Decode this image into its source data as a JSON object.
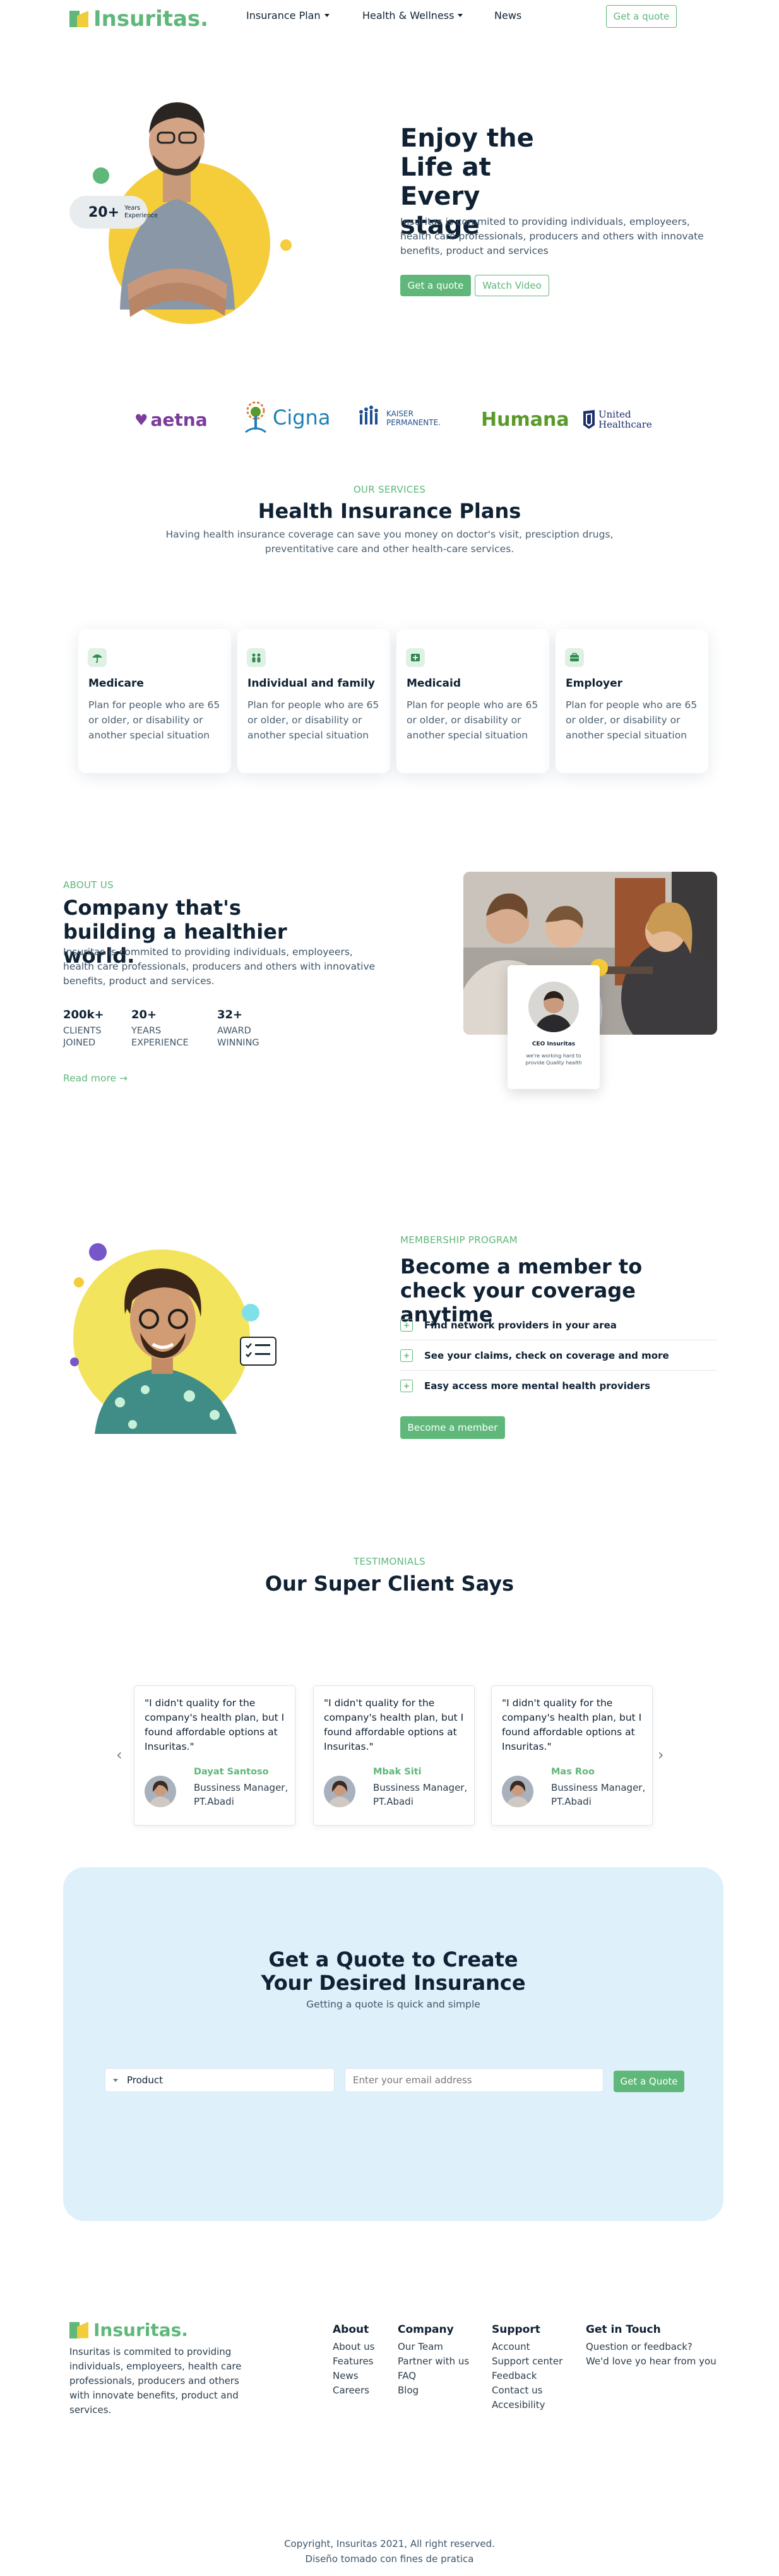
{
  "nav": {
    "logo_text": "Insuritas.",
    "items": [
      {
        "label": "Insurance Plan",
        "dropdown": true
      },
      {
        "label": "Health & Wellness",
        "dropdown": true
      },
      {
        "label": "News",
        "dropdown": false
      }
    ],
    "cta": "Get a quote"
  },
  "hero": {
    "badge_number": "20+",
    "badge_text_1": "Years",
    "badge_text_2": "Experience",
    "title": "Enjoy the Life at Every stage",
    "description": "Insuritas is commited to providing individuals, employeers, health care professionals, producers and others with innovate benefits, product and services",
    "primary_button": "Get a quote",
    "secondary_button": "Watch Video"
  },
  "partners": [
    {
      "name": "aetna",
      "color": "#7b3b9b"
    },
    {
      "name": "Cigna",
      "color": "#1e7fb4"
    },
    {
      "name_line1": "KAISER",
      "name_line2": "PERMANENTE.",
      "color": "#1f4f8c"
    },
    {
      "name": "Humana",
      "color": "#5a9a2a"
    },
    {
      "name_line1": "United",
      "name_line2": "Healthcare",
      "color": "#1c2f6b"
    }
  ],
  "services": {
    "kicker": "OUR SERVICES",
    "title": "Health Insurance Plans",
    "description": "Having health insurance coverage can save you money on doctor's visit, presciption drugs, preventitative care and other health-care services.",
    "cards": [
      {
        "icon": "umbrella-icon",
        "title": "Medicare",
        "text": "Plan for people who are 65 or older, or disability or another special situation"
      },
      {
        "icon": "family-icon",
        "title": "Individual and family",
        "text": "Plan for people who are 65 or older, or disability or another special situation"
      },
      {
        "icon": "medical-icon",
        "title": "Medicaid",
        "text": "Plan for people who are 65 or older, or disability or another special situation"
      },
      {
        "icon": "briefcase-icon",
        "title": "Employer",
        "text": "Plan for people who are 65 or older, or disability or another special situation"
      }
    ]
  },
  "about": {
    "kicker": "ABOUT US",
    "title": "Company that's building a healthier world.",
    "description": "Insuritas is commited to providing individuals, employeers, health care professionals, producers and others with innovative benefits, product and services.",
    "stats": [
      {
        "value": "200k+",
        "label_1": "CLIENTS",
        "label_2": "JOINED"
      },
      {
        "value": "20+",
        "label_1": "YEARS",
        "label_2": "EXPERIENCE"
      },
      {
        "value": "32+",
        "label_1": "AWARD",
        "label_2": "WINNING"
      }
    ],
    "read_more": "Read more →",
    "ceo_title": "CEO Insuritas",
    "ceo_quote": "we're working hard to provide Quality health"
  },
  "membership": {
    "kicker": "MEMBERSHIP PROGRAM",
    "title": "Become a member to check your coverage anytime",
    "features": [
      "Find network providers in your area",
      "See your claims, check on coverage and more",
      "Easy access more mental health providers"
    ],
    "button": "Become a member"
  },
  "testimonials": {
    "kicker": "TESTIMONIALS",
    "title": "Our Super Client Says",
    "items": [
      {
        "quote": "\"I didn't quality for the company's health plan, but I found affordable options at Insuritas.\"",
        "name": "Dayat Santoso",
        "role": "Bussiness Manager, PT.Abadi"
      },
      {
        "quote": "\"I didn't quality for the company's health plan, but I found affordable options at Insuritas.\"",
        "name": "Mbak Siti",
        "role": "Bussiness Manager, PT.Abadi"
      },
      {
        "quote": "\"I didn't quality for the company's health plan, but I found affordable options at Insuritas.\"",
        "name": "Mas Roo",
        "role": "Bussiness Manager, PT.Abadi"
      }
    ]
  },
  "quote": {
    "title": "Get a Quote to Create Your Desired Insurance",
    "subtitle": "Getting a quote is quick and simple",
    "select_value": "Product",
    "email_placeholder": "Enter your email address",
    "button": "Get a Quote"
  },
  "footer": {
    "logo_text": "Insuritas.",
    "description": "Insuritas is commited to providing individuals, employeers, health care professionals, producers and others with innovate benefits, product and services.",
    "columns": [
      {
        "title": "About",
        "links": [
          "About us",
          "Features",
          "News",
          "Careers"
        ]
      },
      {
        "title": "Company",
        "links": [
          "Our Team",
          "Partner with us",
          "FAQ",
          "Blog"
        ]
      },
      {
        "title": "Support",
        "links": [
          "Account",
          "Support center",
          "Feedback",
          "Contact us",
          "Accesibility"
        ]
      },
      {
        "title": "Get in Touch",
        "links": [
          "Question or feedback?",
          "We'd love yo hear from you"
        ]
      }
    ],
    "copyright": "Copyright, Insuritas 2021, All right reserved.",
    "credit": "Diseño tomado con fines de pratica"
  },
  "colors": {
    "brand_green": "#5fb77a",
    "accent_yellow": "#f5cc3a",
    "quote_bg": "#def0fa",
    "heading": "#0f2133"
  }
}
